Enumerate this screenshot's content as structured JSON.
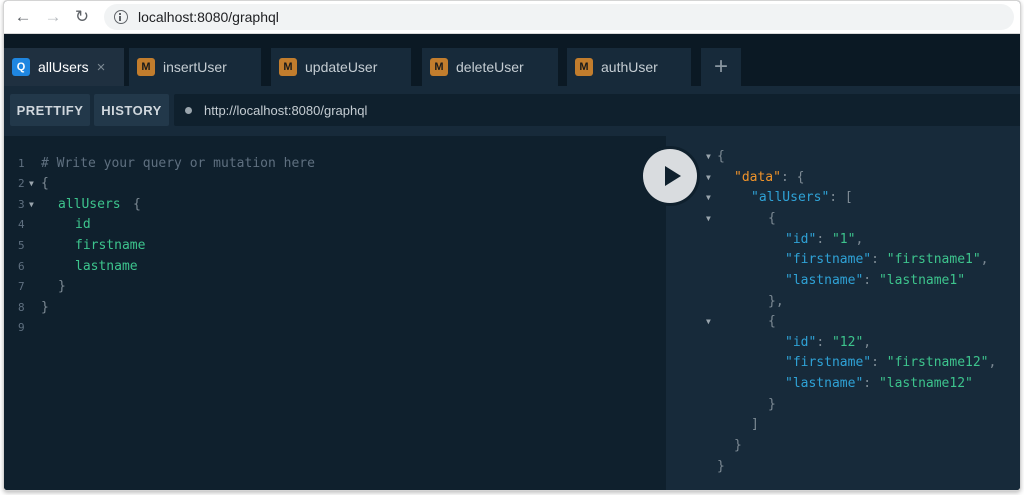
{
  "browser": {
    "url": "localhost:8080/graphql",
    "back_icon": "←",
    "forward_icon": "→",
    "reload_icon": "↻"
  },
  "tabs": [
    {
      "badge": "Q",
      "label": "allUsers",
      "active": true
    },
    {
      "badge": "M",
      "label": "insertUser"
    },
    {
      "badge": "M",
      "label": "updateUser"
    },
    {
      "badge": "M",
      "label": "deleteUser"
    },
    {
      "badge": "M",
      "label": "authUser"
    }
  ],
  "tab_close": "×",
  "tab_add": "+",
  "toolbar": {
    "prettify": "PRETTIFY",
    "history": "HISTORY",
    "endpoint": "http://localhost:8080/graphql"
  },
  "editor": {
    "line_numbers": [
      "1",
      "2",
      "3",
      "4",
      "5",
      "6",
      "7",
      "8",
      "9"
    ],
    "lines": [
      "# Write your query or mutation here",
      "{",
      "allUsers",
      "{",
      "id",
      "firstname",
      "lastname",
      "}",
      "}"
    ]
  },
  "results": {
    "open_brace": "{",
    "data_key": "\"data\"",
    "all_users_key": "\"allUsers\"",
    "open_bracket": "[",
    "close_bracket": "]",
    "close_brace": "}",
    "users": [
      {
        "id_key": "\"id\"",
        "id": "\"1\"",
        "firstname_key": "\"firstname\"",
        "firstname": "\"firstname1\"",
        "lastname_key": "\"lastname\"",
        "lastname": "\"lastname1\""
      },
      {
        "id_key": "\"id\"",
        "id": "\"12\"",
        "firstname_key": "\"firstname\"",
        "firstname": "\"firstname12\"",
        "lastname_key": "\"lastname\"",
        "lastname": "\"lastname12\""
      }
    ]
  },
  "colors": {
    "editor_bg": "#0f202d",
    "results_bg": "#172a3a",
    "field": "#3dc48d",
    "key": "#2fa2d6",
    "data_key": "#f0932a",
    "query_badge": "#1f86e0",
    "mutation_badge": "#c27d2d"
  },
  "icons": {
    "play": "play-icon",
    "fold": "fold-arrow-icon"
  }
}
